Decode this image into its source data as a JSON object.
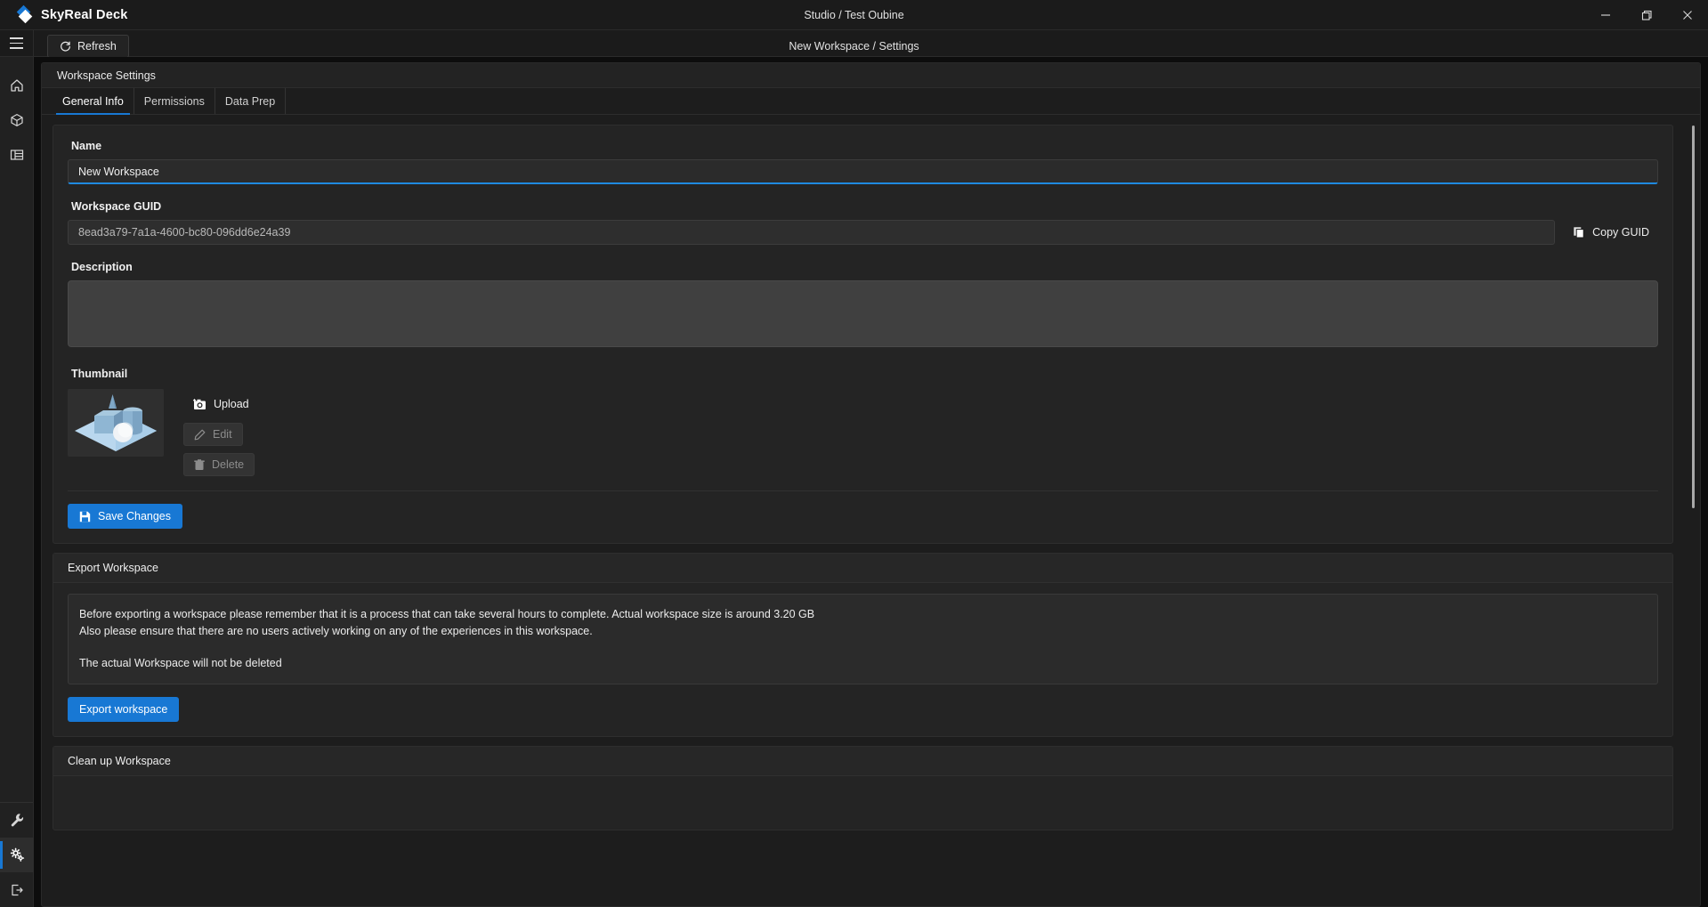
{
  "app": {
    "brand": "SkyReal Deck",
    "window_title": "Studio / Test Oubine",
    "breadcrumb": "New Workspace / Settings",
    "accent_color": "#1878d4"
  },
  "window_controls": {
    "minimize": "minimize-icon",
    "restore": "restore-icon",
    "close": "close-icon"
  },
  "toolbar": {
    "menu_icon": "hamburger-menu-icon",
    "refresh_label": "Refresh",
    "refresh_icon": "refresh-icon"
  },
  "rail": {
    "top_items": [
      {
        "name": "home",
        "icon": "home-icon"
      },
      {
        "name": "assets",
        "icon": "cube-icon"
      },
      {
        "name": "list",
        "icon": "list-icon"
      }
    ],
    "bottom_items": [
      {
        "name": "tools",
        "icon": "wrench-icon",
        "active": false
      },
      {
        "name": "settings",
        "icon": "gears-icon",
        "active": true
      },
      {
        "name": "logout",
        "icon": "logout-icon",
        "active": false
      }
    ]
  },
  "panel": {
    "header": "Workspace Settings",
    "tabs": [
      {
        "label": "General Info",
        "active": true
      },
      {
        "label": "Permissions",
        "active": false
      },
      {
        "label": "Data Prep",
        "active": false
      }
    ]
  },
  "general": {
    "name_label": "Name",
    "name_value": "New Workspace",
    "guid_label": "Workspace GUID",
    "guid_value": "8ead3a79-7a1a-4600-bc80-096dd6e24a39",
    "copy_guid_label": "Copy GUID",
    "copy_guid_icon": "copy-icon",
    "description_label": "Description",
    "description_value": "",
    "thumbnail_label": "Thumbnail",
    "upload_label": "Upload",
    "upload_icon": "camera-add-icon",
    "edit_label": "Edit",
    "edit_icon": "pencil-icon",
    "delete_label": "Delete",
    "delete_icon": "trash-icon",
    "save_label": "Save Changes",
    "save_icon": "save-icon"
  },
  "export": {
    "title": "Export Workspace",
    "line1": "Before exporting a workspace please remember that it is a process that can take several hours to complete. Actual workspace size is around 3.20 GB",
    "line2": "Also please ensure that there are no users actively working on any of the experiences in this workspace.",
    "line3": "The actual Workspace will not be deleted",
    "button_label": "Export workspace"
  },
  "cleanup": {
    "title": "Clean up Workspace"
  }
}
